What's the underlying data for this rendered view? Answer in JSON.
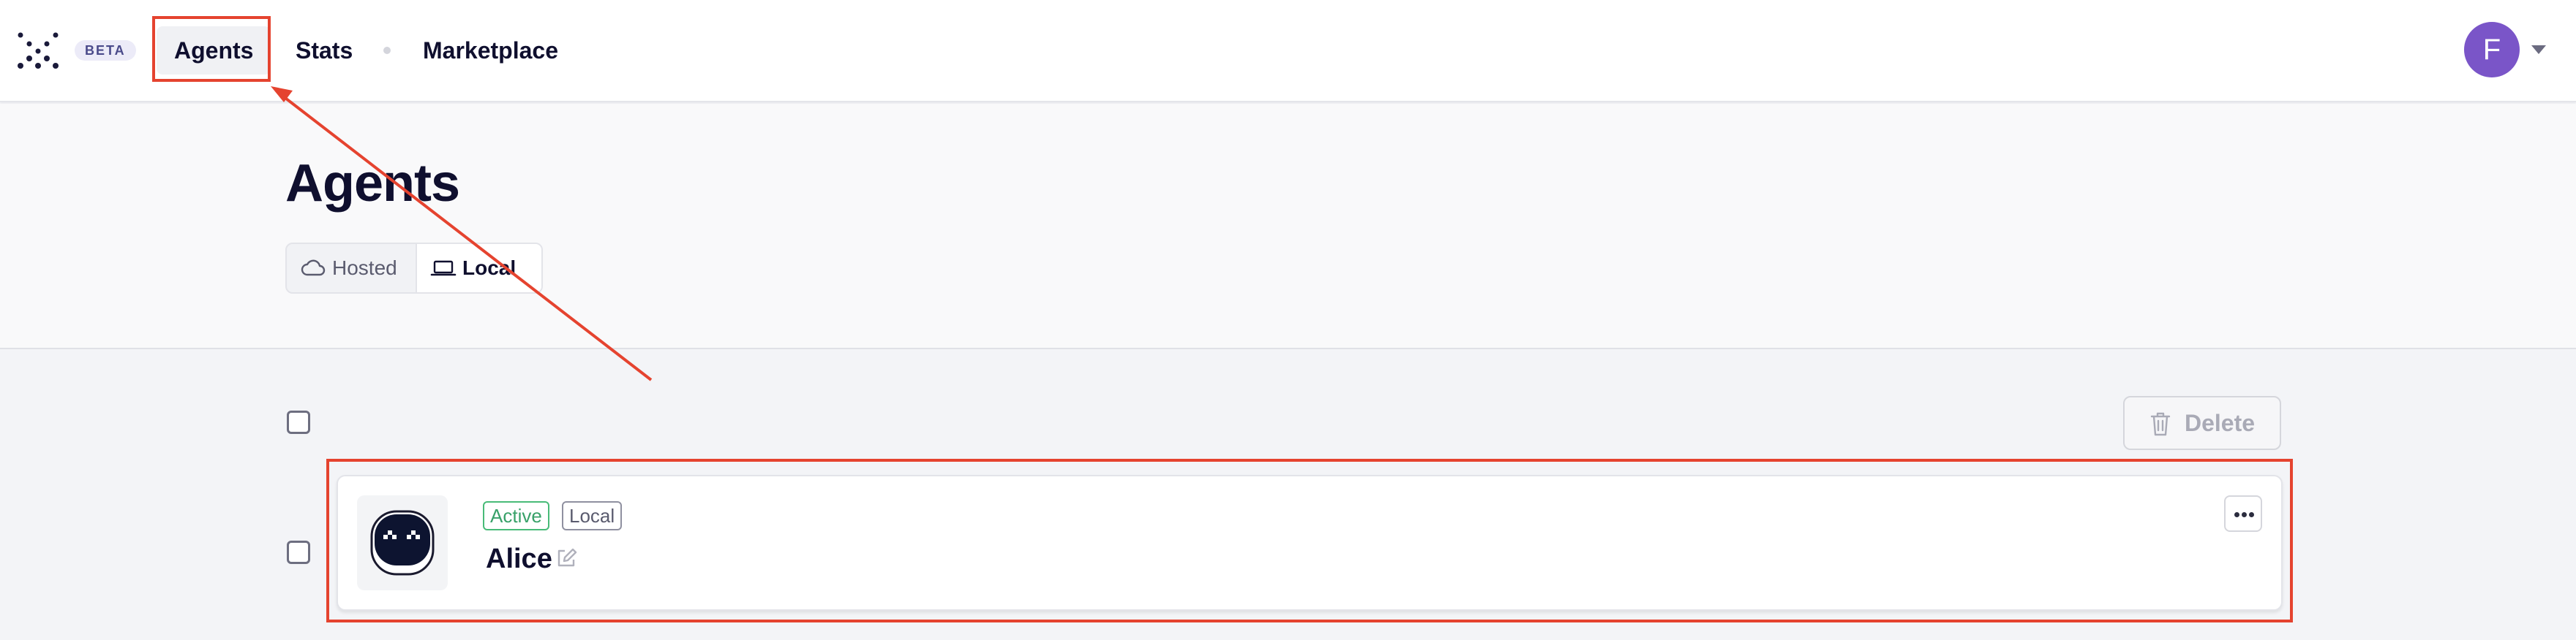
{
  "nav": {
    "beta": "BETA",
    "items": [
      {
        "label": "Agents"
      },
      {
        "label": "Stats"
      },
      {
        "label": "Marketplace"
      }
    ],
    "avatar_initial": "F"
  },
  "header": {
    "title": "Agents",
    "toggle": {
      "hosted": "Hosted",
      "local": "Local",
      "selected": "Local"
    }
  },
  "toolbar": {
    "delete_label": "Delete"
  },
  "agents": [
    {
      "name": "Alice",
      "status": "Active",
      "location": "Local"
    }
  ],
  "colors": {
    "accent_highlight": "#e5432f",
    "active_badge": "#48bb78",
    "avatar": "#7a55c8"
  }
}
